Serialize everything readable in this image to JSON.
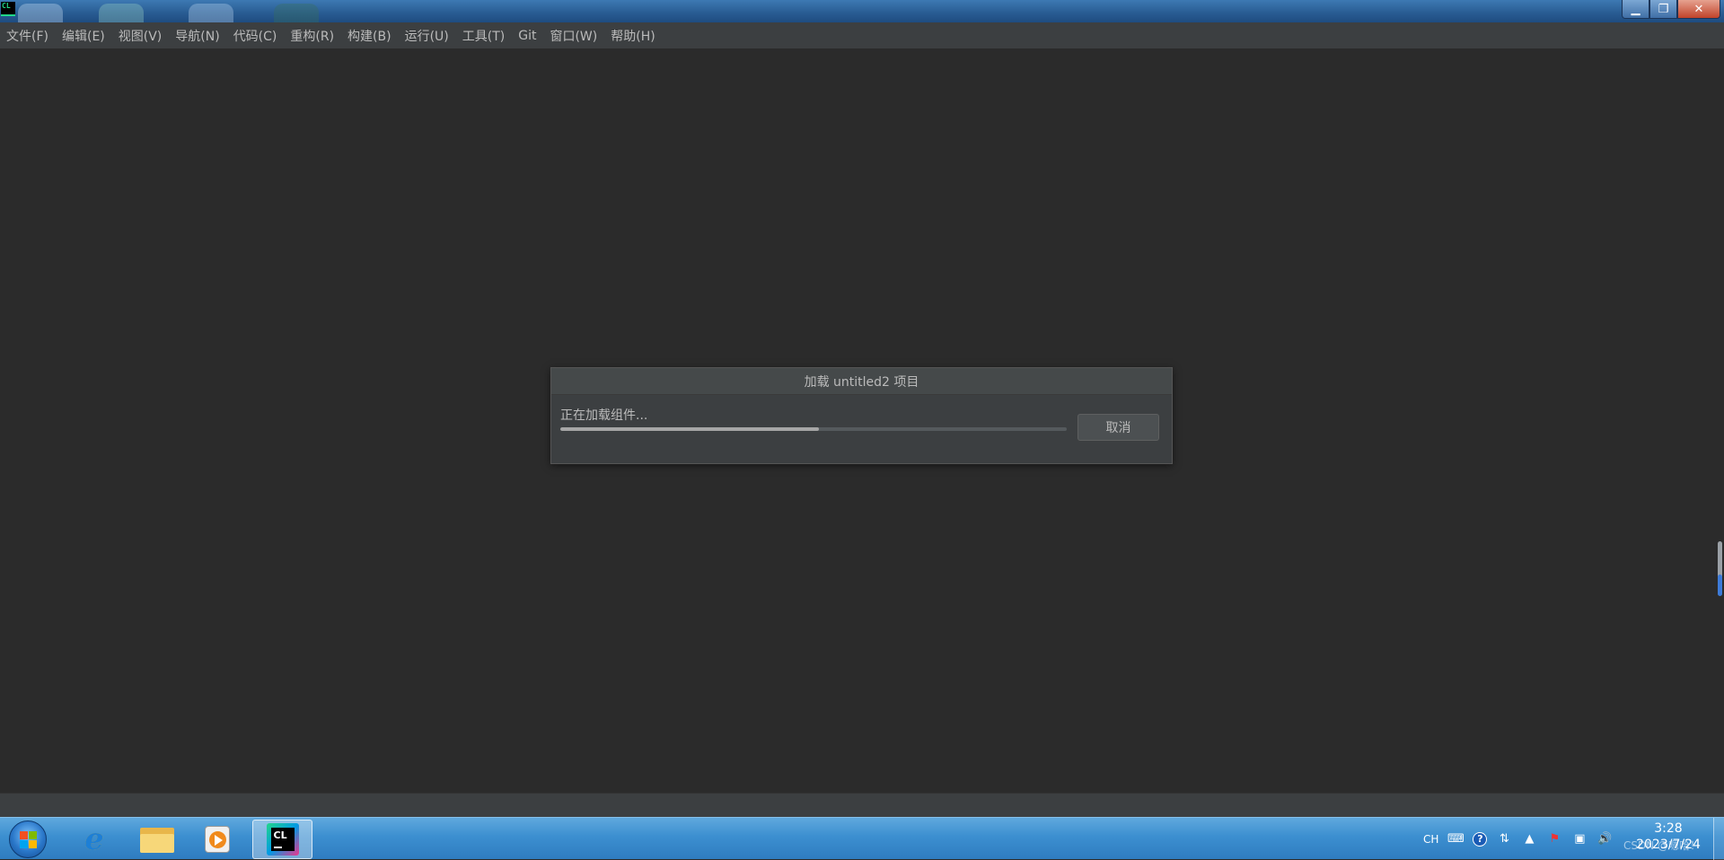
{
  "window": {
    "app_icon_text": "CL",
    "controls": {
      "minimize": "▁",
      "maximize": "❐",
      "close": "✕"
    }
  },
  "menubar": {
    "items": [
      "文件(F)",
      "编辑(E)",
      "视图(V)",
      "导航(N)",
      "代码(C)",
      "重构(R)",
      "构建(B)",
      "运行(U)",
      "工具(T)",
      "Git",
      "窗口(W)",
      "帮助(H)"
    ]
  },
  "dialog": {
    "title": "加载 untitled2 项目",
    "status_text": "正在加载组件...",
    "progress_fraction": 0.51,
    "cancel_label": "取消"
  },
  "taskbar": {
    "apps": [
      {
        "name": "internet-explorer",
        "active": false
      },
      {
        "name": "file-explorer",
        "active": false
      },
      {
        "name": "media-player",
        "active": false
      },
      {
        "name": "clion",
        "active": true,
        "label": "CL"
      }
    ],
    "tray": {
      "input_method": "CH",
      "icons": [
        "keyboard-icon",
        "help-icon",
        "language-bar-icon",
        "show-hidden-icons",
        "action-center-flag-icon",
        "network-icon",
        "volume-icon"
      ]
    },
    "clock": {
      "time": "3:28",
      "date": "2023/7/24"
    },
    "watermark": "CSDN @嗯哈！"
  },
  "colors": {
    "ide_background": "#2b2b2b",
    "menubar_background": "#3c3f41",
    "dialog_background": "#3c3f41",
    "progress_fill": "#a6a6a6",
    "taskbar_blue": "#3c8fd0"
  }
}
